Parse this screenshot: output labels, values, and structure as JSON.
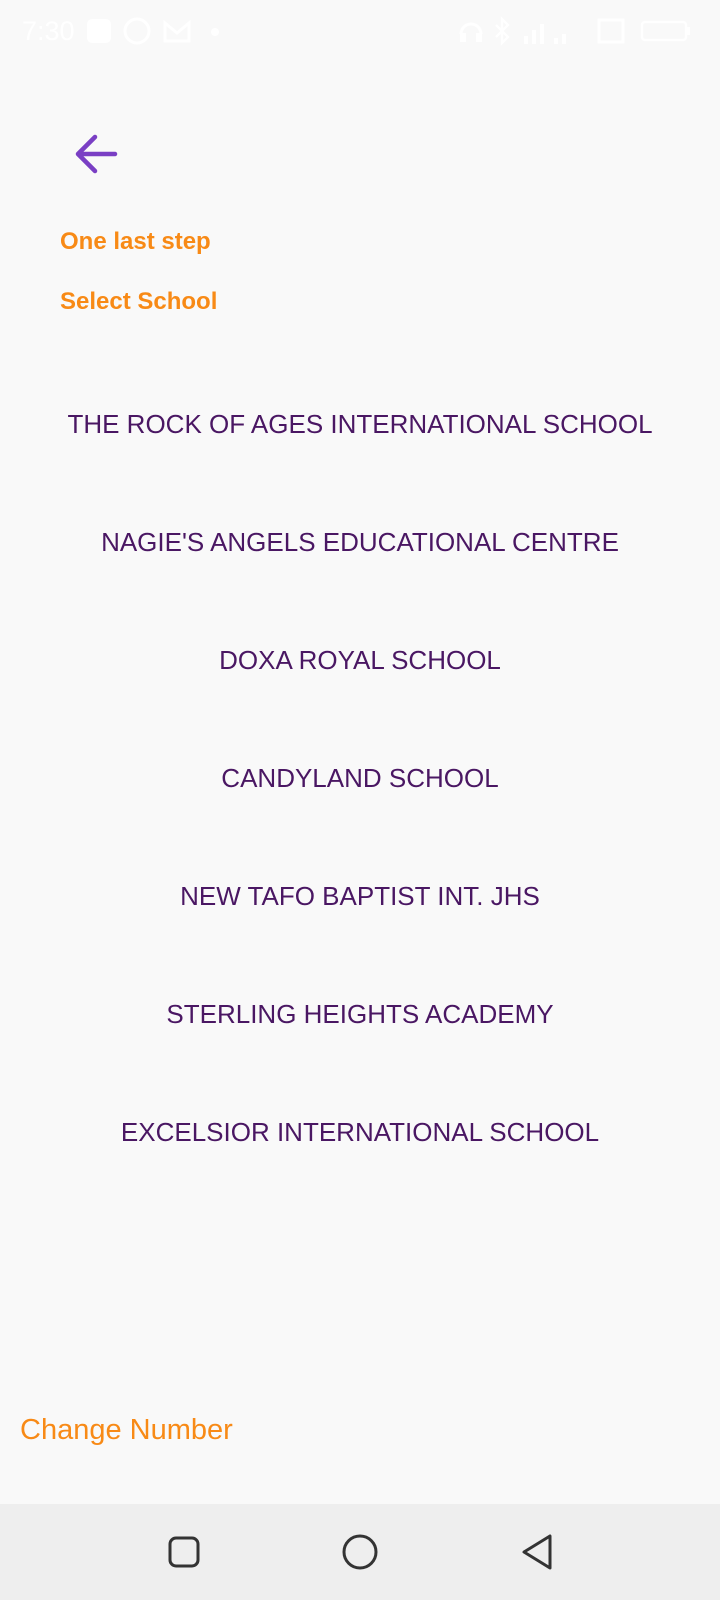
{
  "status_bar": {
    "time": "7:30",
    "icons": [
      "notification-icon",
      "whatsapp-icon",
      "gmail-icon",
      "dot-icon",
      "headset-icon",
      "bluetooth-icon",
      "signal-icon",
      "wifi-speed-icon",
      "battery-icon"
    ]
  },
  "header": {
    "back_icon": "arrow-left-icon",
    "step_label": "One last step",
    "select_label": "Select School"
  },
  "schools": [
    "THE ROCK OF AGES INTERNATIONAL SCHOOL",
    "NAGIE'S ANGELS EDUCATIONAL CENTRE",
    "DOXA ROYAL SCHOOL",
    "CANDYLAND SCHOOL",
    "NEW TAFO BAPTIST INT. JHS",
    "STERLING HEIGHTS ACADEMY",
    "EXCELSIOR INTERNATIONAL SCHOOL"
  ],
  "footer": {
    "change_number_label": "Change Number"
  },
  "nav": {
    "icons": [
      "square-recents-icon",
      "circle-home-icon",
      "triangle-back-icon"
    ]
  },
  "colors": {
    "accent_orange": "#f88a16",
    "school_text": "#4a1763",
    "back_arrow": "#7a3fc4",
    "background": "#f9f9f9",
    "nav_bar": "#eeeeee"
  }
}
